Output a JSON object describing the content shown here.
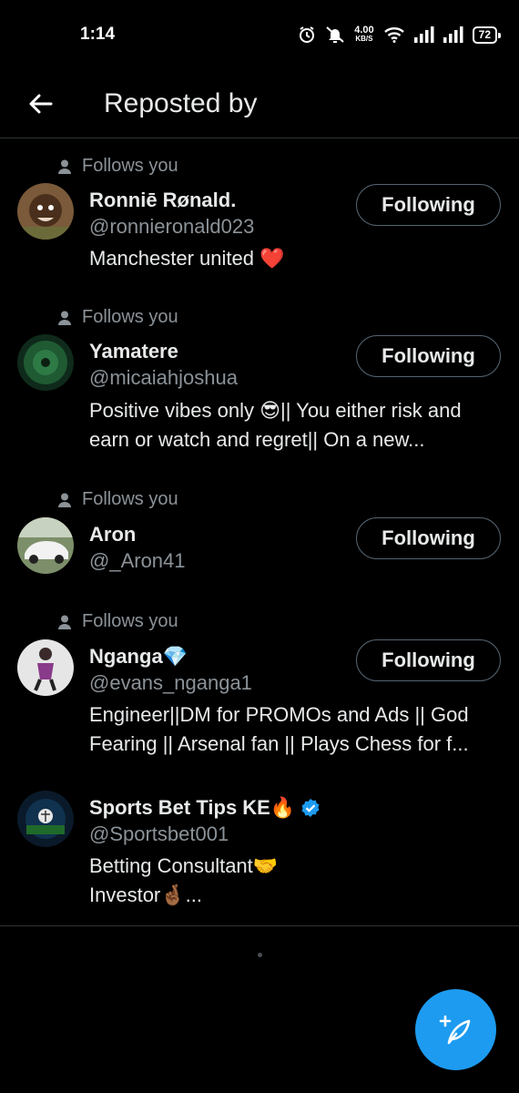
{
  "status": {
    "time": "1:14",
    "speed_value": "4.00",
    "speed_unit": "KB/S",
    "battery": "72"
  },
  "header": {
    "title": "Reposted by"
  },
  "users": [
    {
      "follows_label": "Follows you",
      "name": "Ronniē Rønald.",
      "handle": "@ronnieronald023",
      "bio": "Manchester united ❤️",
      "button": "Following"
    },
    {
      "follows_label": "Follows you",
      "name": "Yamatere",
      "handle": "@micaiahjoshua",
      "bio": "Positive vibes only 😎|| You either risk and earn or watch and regret|| On a new...",
      "button": "Following"
    },
    {
      "follows_label": "Follows you",
      "name": "Aron",
      "handle": "@_Aron41",
      "bio": "",
      "button": "Following"
    },
    {
      "follows_label": "Follows you",
      "name": "Nganga💎",
      "handle": "@evans_nganga1",
      "bio": "Engineer||DM for PROMOs and Ads || God Fearing || Arsenal fan || Plays Chess for f...",
      "button": "Following"
    },
    {
      "follows_label": "",
      "name": "Sports Bet Tips KE🔥",
      "handle": "@Sportsbet001",
      "bio_line1": "Betting Consultant🤝",
      "bio_line2": "Investor🤞🏾...",
      "button": ""
    }
  ],
  "colors": {
    "accent": "#1d9bf0",
    "muted": "#8b9298",
    "text": "#e7e9ea",
    "background": "#000000"
  }
}
